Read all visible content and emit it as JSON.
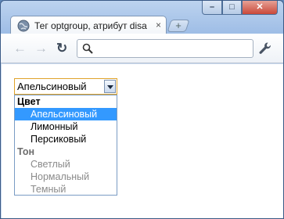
{
  "tab": {
    "title": "Тег optgroup, атрибут disa",
    "close": "×",
    "new_tab": "+"
  },
  "window_controls": {
    "minimize": "–",
    "maximize": "□",
    "close": "✕"
  },
  "toolbar": {
    "back": "←",
    "forward": "→",
    "reload": "↻",
    "omnibox_value": ""
  },
  "select": {
    "selected_value": "Апельсиновый",
    "groups": [
      {
        "label": "Цвет",
        "disabled": false,
        "options": [
          "Апельсиновый",
          "Лимонный",
          "Персиковый"
        ]
      },
      {
        "label": "Тон",
        "disabled": true,
        "options": [
          "Светлый",
          "Нормальный",
          "Темный"
        ]
      }
    ]
  },
  "colors": {
    "highlight": "#3399ff",
    "focus_border": "#e0a32a"
  }
}
